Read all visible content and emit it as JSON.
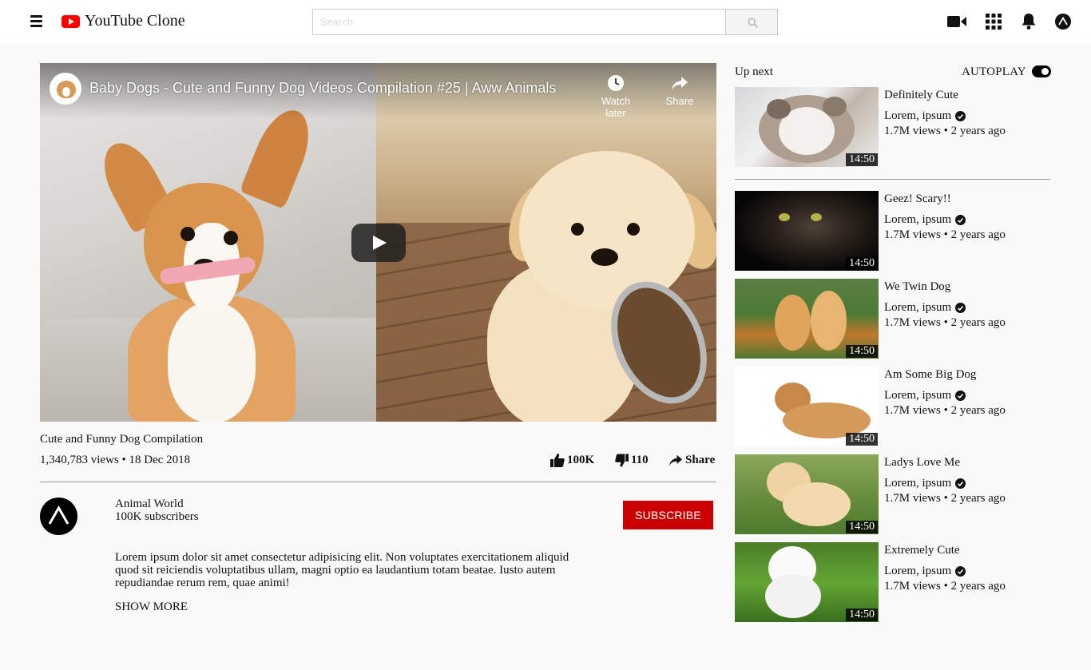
{
  "header": {
    "app_title": "YouTube Clone",
    "search_placeholder": "Search",
    "icons": [
      "menu-icon",
      "youtube-logo-icon",
      "search-icon",
      "video-camera-icon",
      "apps-grid-icon",
      "bell-icon",
      "account-icon"
    ]
  },
  "player": {
    "title": "Baby Dogs - Cute and Funny Dog Videos Compilation #25 | Aww Animals",
    "watch_later_label": "Watch later",
    "share_label": "Share"
  },
  "video": {
    "title": "Cute and Funny Dog Compilation",
    "views_date": "1,340,783 views • 18 Dec 2018",
    "likes": "100K",
    "dislikes": "110",
    "share_label": "Share"
  },
  "channel": {
    "name": "Animal World",
    "subscribers": "100K subscribers",
    "subscribe_label": "SUBSCRIBE",
    "description": "Lorem ipsum dolor sit amet consectetur adipisicing elit. Non voluptates exercitationem aliquid quod sit reiciendis voluptatibus ullam, magni optio ea laudantium totam beatae. Iusto autem repudiandae rerum rem, quae animi!",
    "show_more_label": "SHOW MORE"
  },
  "sidebar": {
    "up_next_label": "Up next",
    "autoplay_label": "AUTOPLAY",
    "autoplay_on": true,
    "videos": [
      {
        "title": "Definitely Cute",
        "channel": "Lorem, ipsum",
        "stats": "1.7M views • 2 years ago",
        "duration": "14:50"
      },
      {
        "title": "Geez! Scary!!",
        "channel": "Lorem, ipsum",
        "stats": "1.7M views • 2 years ago",
        "duration": "14:50"
      },
      {
        "title": "We Twin Dog",
        "channel": "Lorem, ipsum",
        "stats": "1.7M views • 2 years ago",
        "duration": "14:50"
      },
      {
        "title": "Am Some Big Dog",
        "channel": "Lorem, ipsum",
        "stats": "1.7M views • 2 years ago",
        "duration": "14:50"
      },
      {
        "title": "Ladys Love Me",
        "channel": "Lorem, ipsum",
        "stats": "1.7M views • 2 years ago",
        "duration": "14:50"
      },
      {
        "title": "Extremely Cute",
        "channel": "Lorem, ipsum",
        "stats": "1.7M views • 2 years ago",
        "duration": "14:50"
      }
    ]
  },
  "colors": {
    "brand_red": "#ff0000",
    "subscribe_red": "#cc0000",
    "page_bg": "#f9f9f9"
  }
}
